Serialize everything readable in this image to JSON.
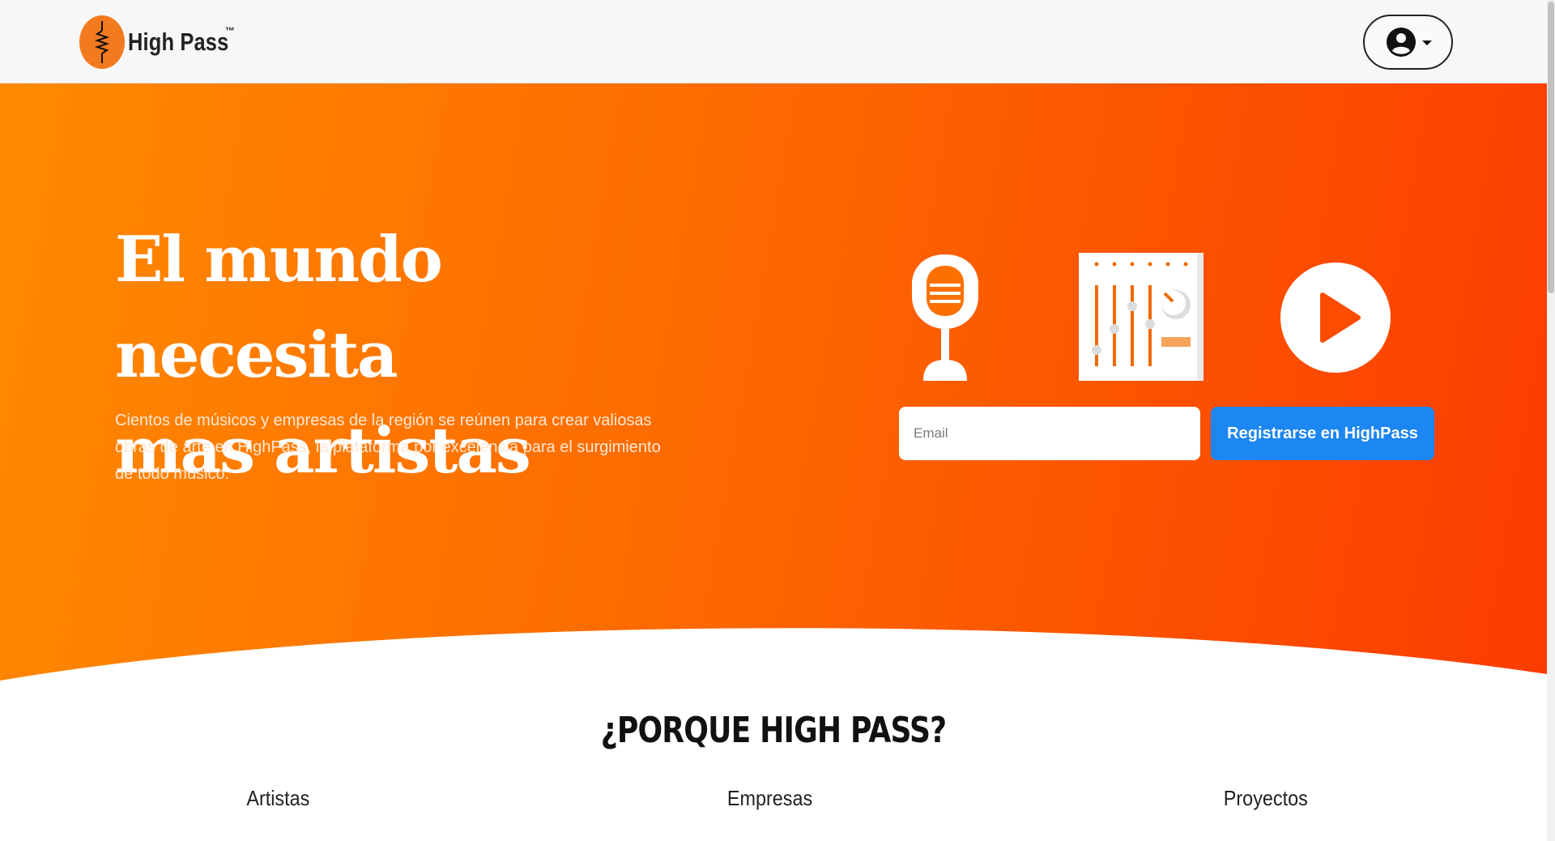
{
  "brand": {
    "name": "High Pass",
    "tm": "™"
  },
  "nav": {
    "user_menu_icon": "user-circle-icon"
  },
  "hero": {
    "title_line1": "El mundo necesita",
    "title_line2": "mas artistas",
    "subtitle": "Cientos de músicos y empresas de la región se reúnen para crear valiosas obras de arte en HighPass, la plataforma por excelencia para el surgimiento de todo músico.",
    "icons": [
      "microphone-icon",
      "mixer-icon",
      "play-icon"
    ],
    "email_placeholder": "Email",
    "register_label": "Registrarse en HighPass"
  },
  "section": {
    "title": "¿PORQUE HIGH PASS?",
    "features": [
      "Artistas",
      "Empresas",
      "Proyectos"
    ]
  },
  "colors": {
    "gradient_start": "#ff8a00",
    "gradient_end": "#fb3c00",
    "button_blue": "#1c86f2",
    "logo_orange": "#f47a1f"
  }
}
